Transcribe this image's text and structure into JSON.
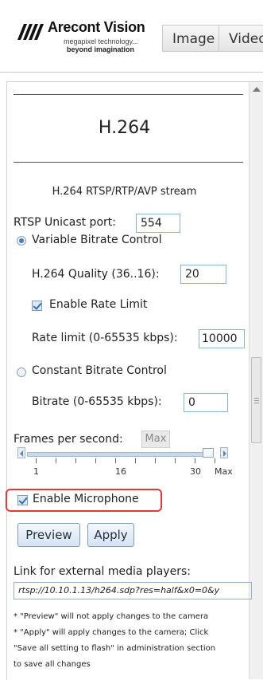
{
  "header": {
    "logo": {
      "brand": "Arecont Vision",
      "tagline_line1": "megapixel technology...",
      "tagline_line2": "beyond imagination"
    },
    "tabs": [
      {
        "label": "Image"
      },
      {
        "label": "Video"
      }
    ]
  },
  "section": {
    "title": "H.264",
    "stream_label": "H.264 RTSP/RTP/AVP stream"
  },
  "rtsp": {
    "label": "RTSP Unicast port:",
    "value": "554"
  },
  "variable_bitrate": {
    "label": "Variable Bitrate Control",
    "selected": true,
    "quality_label": "H.264 Quality (36..16):",
    "quality_value": "20",
    "rate_limit_check_label": "Enable Rate Limit",
    "rate_limit_checked": true,
    "rate_limit_label": "Rate limit (0-65535 kbps):",
    "rate_limit_value": "10000"
  },
  "constant_bitrate": {
    "label": "Constant Bitrate Control",
    "selected": false,
    "bitrate_label": "Bitrate (0-65535 kbps):",
    "bitrate_value": "0"
  },
  "fps": {
    "label": "Frames per second:",
    "value": "Max",
    "ticks": [
      "1",
      "16",
      "30",
      "Max"
    ]
  },
  "microphone": {
    "label": "Enable Microphone",
    "checked": true
  },
  "buttons": {
    "preview": "Preview",
    "apply": "Apply"
  },
  "external_link": {
    "label": "Link for external media players:",
    "value": "rtsp://10.10.1.13/h264.sdp?res=half&x0=0&y"
  },
  "notes": [
    "* \"Preview\" will not apply changes to the camera",
    "* \"Apply\" will apply changes to the camera; Click",
    "\"Save all setting to flash\" in administration section",
    "to save all changes"
  ],
  "colors": {
    "input_border": "#8fb0cf",
    "highlight": "#e0393e",
    "button_bg": "#d6e3f1"
  }
}
